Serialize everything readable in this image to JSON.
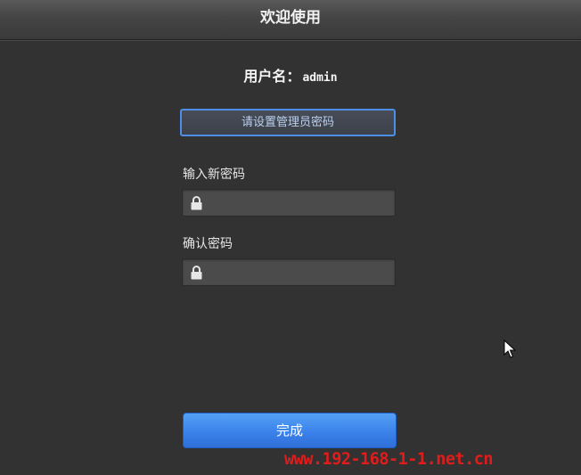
{
  "header": {
    "title": "欢迎使用"
  },
  "username": {
    "label": "用户名：",
    "value": "admin"
  },
  "hint": {
    "text": "请设置管理员密码"
  },
  "fields": [
    {
      "label": "输入新密码",
      "value": "",
      "icon": "lock-icon"
    },
    {
      "label": "确认密码",
      "value": "",
      "icon": "lock-icon"
    }
  ],
  "actions": {
    "done_label": "完成"
  },
  "colors": {
    "accent": "#3b82ea",
    "hint_border": "#4f8ee6",
    "background": "#323232",
    "watermark": "#e21b1b"
  },
  "watermark": {
    "text": "www.192-168-1-1.net.cn"
  }
}
